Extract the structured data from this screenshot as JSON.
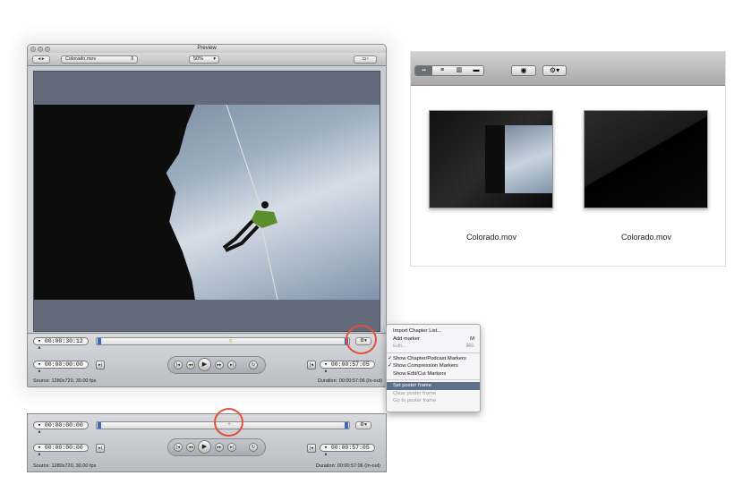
{
  "preview": {
    "title": "Preview",
    "file_select": "Colorado.mov",
    "zoom": "50%",
    "current_timecode": "00:00:30:12",
    "in_timecode": "00:00:00:00",
    "out_timecode": "00:00:57:05",
    "source": "Source: 1280x720, 30.00 fps",
    "duration": "Duration: 00:00:57:06 (In-out)",
    "gear_label": "⚙▾"
  },
  "menu": {
    "items": [
      {
        "label": "Import Chapter List...",
        "key": ""
      },
      {
        "label": "Add marker",
        "key": "M"
      },
      {
        "label": "Edit...",
        "key": "⌘E"
      },
      {
        "label": "Show Chapter/Podcast Markers"
      },
      {
        "label": "Show Compression Markers"
      },
      {
        "label": "Show Edit/Cut Markers"
      },
      {
        "label": "Set poster frame"
      },
      {
        "label": "Clear poster frame"
      },
      {
        "label": "Go to poster frame"
      }
    ]
  },
  "finder": {
    "items": [
      {
        "label": "Colorado.mov"
      },
      {
        "label": "Colorado.mov"
      }
    ]
  },
  "strip": {
    "current_timecode": "00:00:00:00",
    "in_timecode": "00:00:00:00",
    "out_timecode": "00:00:57:05",
    "source": "Source: 1280x720, 30.00 fps",
    "duration": "Duration: 00:00:57:06 (In-out)"
  },
  "colors": {
    "highlight": "#e2513e",
    "menu_selected": "#5f6f8a"
  }
}
